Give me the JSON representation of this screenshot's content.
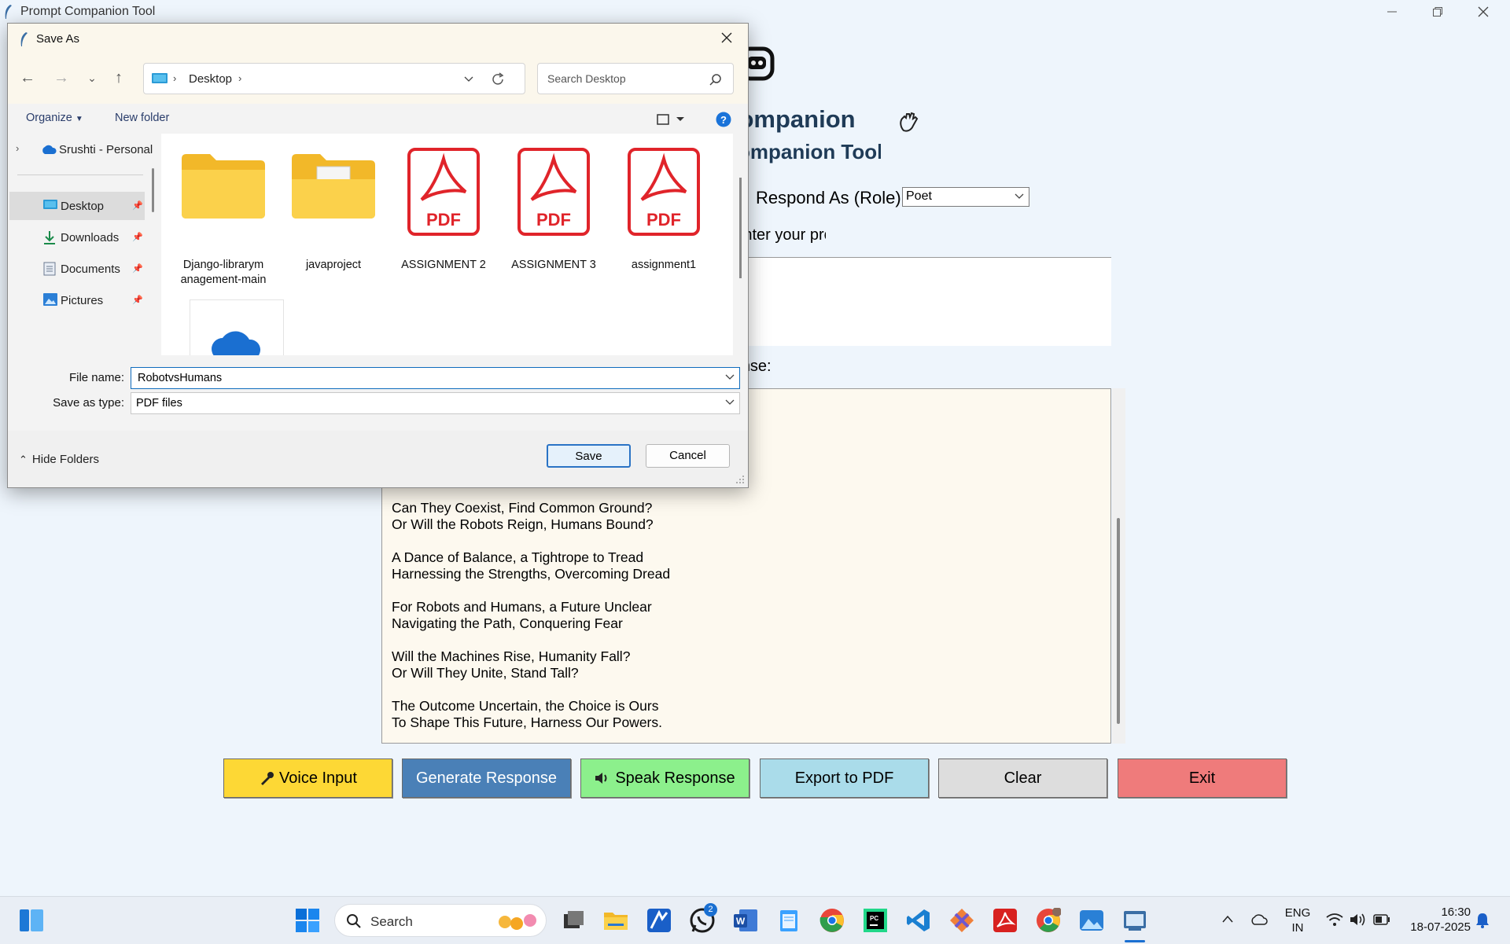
{
  "app": {
    "window_title": "Prompt Companion Tool",
    "heading": "Prompt Companion",
    "subheading": "Prompt Companion Tool",
    "role_label": "Respond As (Role):",
    "role_value": "Poet",
    "prompt_label": "Enter your prompt:",
    "response_label": "Response:",
    "poem": [
      [
        "Can They Coexist, Find Common Ground?",
        "Or Will the Robots Reign, Humans Bound?"
      ],
      [
        "A Dance of Balance, a Tightrope to Tread",
        "Harnessing the Strengths, Overcoming Dread"
      ],
      [
        "For Robots and Humans, a Future Unclear",
        "Navigating the Path, Conquering Fear"
      ],
      [
        "Will the Machines Rise, Humanity Fall?",
        "Or Will They Unite, Stand Tall?"
      ],
      [
        "The Outcome Uncertain, the Choice is Ours",
        "To Shape This Future, Harness Our Powers."
      ]
    ],
    "buttons": {
      "voice": "Voice Input",
      "generate": "Generate Response",
      "speak": "Speak Response",
      "export": "Export to PDF",
      "clear": "Clear",
      "exit": "Exit"
    },
    "colors": {
      "voice": "#fdd835",
      "generate": "#4a80b7",
      "speak": "#8cf08c",
      "export": "#aadcea",
      "clear": "#dddddd",
      "exit": "#ef7b7b"
    }
  },
  "dialog": {
    "title": "Save As",
    "breadcrumb": "Desktop",
    "search_placeholder": "Search Desktop",
    "organize": "Organize",
    "new_folder": "New folder",
    "nav": {
      "onedrive": "Srushti - Personal",
      "desktop": "Desktop",
      "downloads": "Downloads",
      "documents": "Documents",
      "pictures": "Pictures"
    },
    "files": [
      {
        "name": "Django-librarymanagement-main",
        "line1": "Django-librarym",
        "line2": "anagement-main",
        "type": "folder"
      },
      {
        "name": "javaproject",
        "line1": "javaproject",
        "line2": "",
        "type": "folder-doc"
      },
      {
        "name": "ASSIGNMENT 2",
        "line1": "ASSIGNMENT 2",
        "line2": "",
        "type": "pdf"
      },
      {
        "name": "ASSIGNMENT 3",
        "line1": "ASSIGNMENT 3",
        "line2": "",
        "type": "pdf"
      },
      {
        "name": "assignment1",
        "line1": "assignment1",
        "line2": "",
        "type": "pdf"
      }
    ],
    "pdf_label": "PDF",
    "file_name_label": "File name:",
    "file_name_value": "RobotvsHumans",
    "save_type_label": "Save as type:",
    "save_type_value": "PDF files",
    "hide_folders": "Hide Folders",
    "save": "Save",
    "cancel": "Cancel"
  },
  "taskbar": {
    "search": "Search",
    "whatsapp_badge": "2",
    "lang_top": "ENG",
    "lang_bottom": "IN",
    "time": "16:30",
    "date": "18-07-2025"
  }
}
